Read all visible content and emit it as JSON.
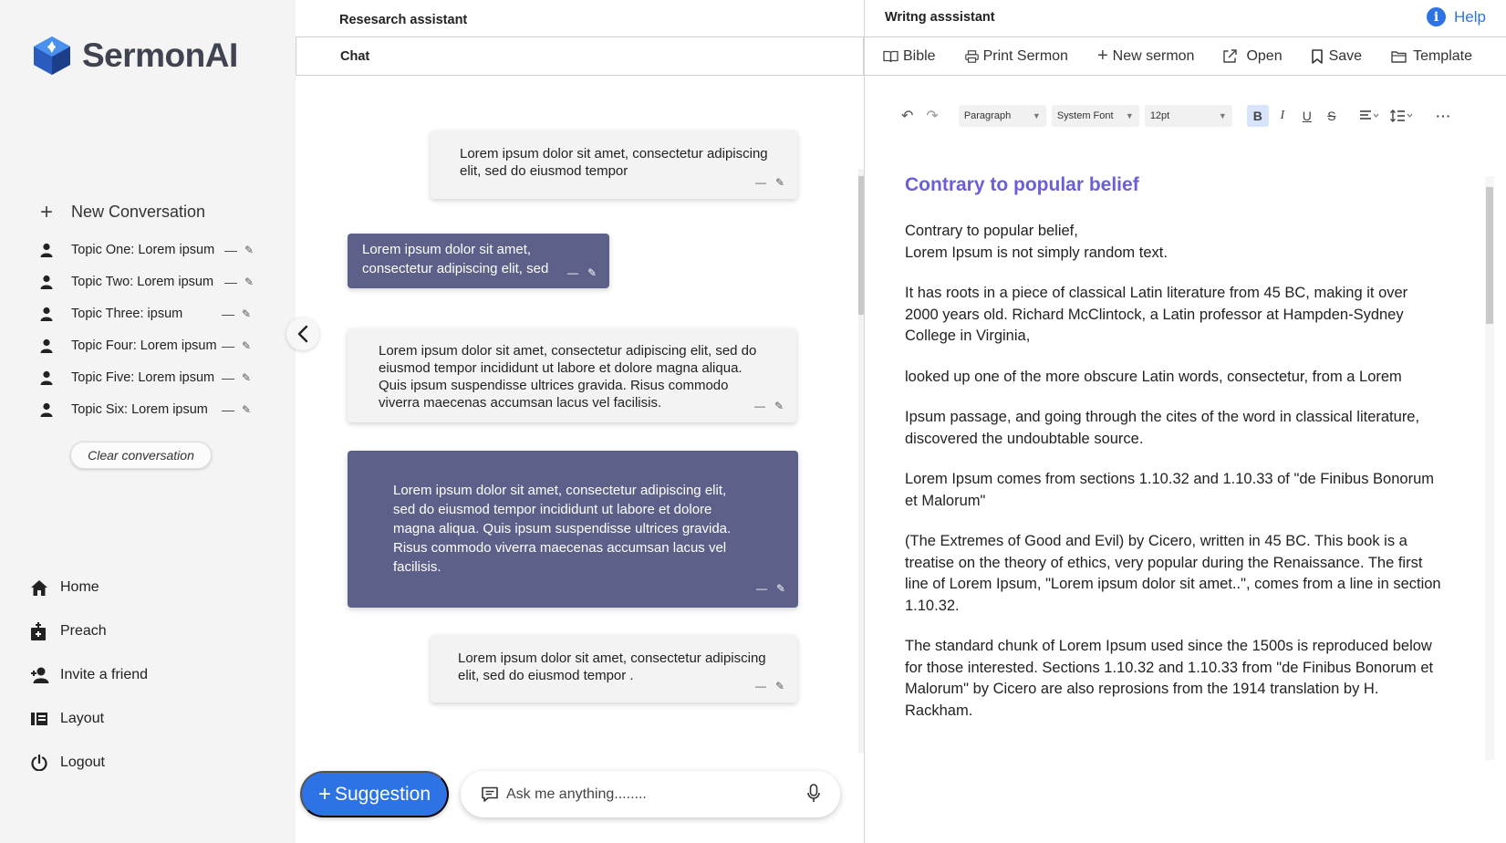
{
  "app": {
    "brand": "SermonAI",
    "colors": {
      "accent_blue": "#2e73e6",
      "bubble_dark": "#5d6089",
      "heading_purple": "#6b5fd9",
      "logo_dark": "#3f4450"
    }
  },
  "sidebar": {
    "new_conversation": "New Conversation",
    "topics": [
      {
        "label": "Topic One: Lorem ipsum",
        "icon": "person-icon"
      },
      {
        "label": "Topic Two: Lorem ipsum",
        "icon": "person-icon"
      },
      {
        "label": "Topic Three:  ipsum",
        "icon": "person-icon"
      },
      {
        "label": "Topic Four: Lorem ipsum",
        "icon": "person-icon"
      },
      {
        "label": "Topic Five: Lorem ipsum",
        "icon": "person-icon"
      },
      {
        "label": "Topic Six: Lorem ipsum",
        "icon": "person-icon"
      }
    ],
    "clear_label": "Clear conversation",
    "nav": [
      {
        "label": "Home",
        "icon": "home-icon"
      },
      {
        "label": "Preach",
        "icon": "preach-icon"
      },
      {
        "label": "Invite a friend",
        "icon": "add-user-icon"
      },
      {
        "label": "Layout",
        "icon": "layout-icon"
      },
      {
        "label": "Logout",
        "icon": "power-icon"
      }
    ]
  },
  "chat": {
    "title": "Resesarch assistant",
    "tab": "Chat",
    "messages": [
      {
        "style": "light",
        "text": "Lorem ipsum dolor sit amet, consectetur adipiscing elit, sed do eiusmod tempor"
      },
      {
        "style": "dark",
        "text": "Lorem ipsum dolor sit amet, consectetur adipiscing elit, sed"
      },
      {
        "style": "light",
        "text": "Lorem ipsum dolor sit amet, consectetur adipiscing elit, sed do eiusmod tempor incididunt ut labore et dolore magna aliqua. Quis ipsum suspendisse ultrices gravida. Risus commodo viverra maecenas accumsan lacus vel facilisis."
      },
      {
        "style": "dark",
        "text": "Lorem ipsum dolor sit amet, consectetur adipiscing elit, sed do eiusmod tempor incididunt ut labore et dolore magna aliqua. Quis ipsum suspendisse ultrices gravida. Risus commodo viverra maecenas accumsan lacus vel facilisis."
      },
      {
        "style": "light",
        "text": "Lorem ipsum dolor sit amet, consectetur adipiscing elit, sed do eiusmod tempor ."
      }
    ],
    "suggestion_label": "Suggestion",
    "input_placeholder": "Ask me anything........"
  },
  "writer": {
    "title": "Writng asssistant",
    "help": "Help",
    "toolbar": [
      {
        "label": "Bible",
        "icon": "book-icon"
      },
      {
        "label": "Print Sermon",
        "icon": "printer-icon"
      },
      {
        "label": "New sermon",
        "icon": "plus-icon"
      },
      {
        "label": "Open",
        "icon": "open-icon"
      },
      {
        "label": "Save",
        "icon": "bookmark-icon"
      },
      {
        "label": "Template",
        "icon": "folder-icon"
      }
    ],
    "format": {
      "block": "Paragraph",
      "font": "System Font",
      "size": "12pt"
    },
    "doc": {
      "heading": "Contrary to popular belief",
      "paragraphs": [
        [
          "Contrary to popular belief,",
          "Lorem Ipsum is not simply random text."
        ],
        [
          "It has roots in a piece of classical Latin literature from 45 BC, making it over 2000 years old. Richard McClintock, a Latin professor at Hampden-Sydney College in Virginia,"
        ],
        [
          "looked up one of the more obscure Latin words, consectetur, from a Lorem"
        ],
        [
          "Ipsum passage, and going through the cites of the word in classical literature, discovered the undoubtable source."
        ],
        [
          "Lorem Ipsum comes from sections 1.10.32 and 1.10.33 of \"de Finibus Bonorum et Malorum\""
        ],
        [
          "(The Extremes of Good and Evil) by Cicero, written in 45 BC. This book is a treatise on the theory of ethics, very popular during the Renaissance. The first line of Lorem Ipsum, \"Lorem ipsum dolor sit amet..\", comes from a line in section 1.10.32."
        ],
        [
          "The standard chunk of Lorem Ipsum used since the 1500s is reproduced below for those interested. Sections 1.10.32 and 1.10.33 from \"de Finibus Bonorum et Malorum\" by Cicero are also reprosions from the 1914 translation by H. Rackham."
        ]
      ]
    }
  }
}
